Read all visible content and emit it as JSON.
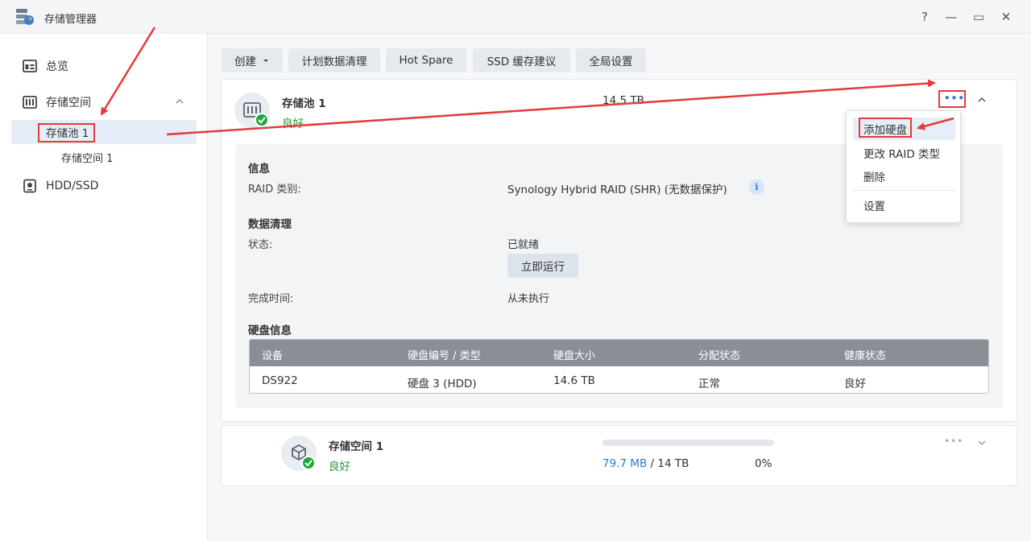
{
  "window": {
    "title": "存储管理器",
    "help": "?",
    "minimize": "—",
    "maximize": "▭",
    "close": "✕"
  },
  "sidebar": {
    "overview": "总览",
    "storage": "存储空间",
    "pool": "存储池 1",
    "volume": "存储空间 1",
    "hdd": "HDD/SSD"
  },
  "toolbar": {
    "create": "创建",
    "schedule": "计划数据清理",
    "hot_spare": "Hot Spare",
    "ssd_cache": "SSD 缓存建议",
    "global": "全局设置"
  },
  "pool": {
    "name": "存储池 1",
    "status": "良好",
    "size": "14.5 TB",
    "more": "•••"
  },
  "info": {
    "section_info": "信息",
    "raid_label": "RAID 类别:",
    "raid_value": "Synology Hybrid RAID (SHR) (无数据保护)",
    "info_icon": "i",
    "section_scrub": "数据清理",
    "state_label": "状态:",
    "state_value": "已就绪",
    "run_now": "立即运行",
    "completed_label": "完成时间:",
    "completed_value": "从未执行",
    "section_disk": "硬盘信息"
  },
  "table": {
    "headers": [
      "设备",
      "硬盘编号 / 类型",
      "硬盘大小",
      "分配状态",
      "健康状态"
    ],
    "row": [
      "DS922",
      "硬盘 3 (HDD)",
      "14.6 TB",
      "正常",
      "良好"
    ]
  },
  "volume": {
    "name": "存储空间 1",
    "status": "良好",
    "used": "79.7 MB",
    "separator": " / ",
    "total": "14 TB",
    "percent": "0%",
    "usage_fraction": 0.0,
    "more": "•••"
  },
  "menu": {
    "add_disk": "添加硬盘",
    "change_raid": "更改 RAID 类型",
    "delete": "删除",
    "settings": "设置"
  },
  "colors": {
    "accent": "#2a7ad8",
    "ok": "#1a9c33",
    "annotation": "#e53a3a"
  }
}
